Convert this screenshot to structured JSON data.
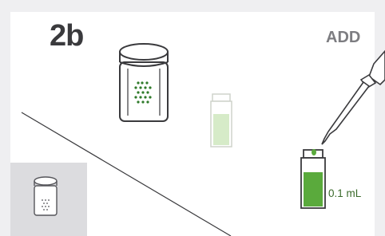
{
  "step": {
    "label": "2b"
  },
  "action": {
    "label": "ADD"
  },
  "volume": {
    "label": "0.1 mL"
  },
  "colors": {
    "background": "#efeff1",
    "panel": "#ffffff",
    "thumbnail_background": "#dcdcdf",
    "liquid_green": "#5aaa3c",
    "liquid_green_faded": "#d6ebc8",
    "dot_green": "#2f7a2a",
    "outline": "#3a3a3d"
  },
  "icons": {
    "jar": "reagent-jar-icon",
    "empty_cuvette": "cuvette-faded-icon",
    "filled_cuvette": "cuvette-filled-icon",
    "pipette": "pipette-icon",
    "thumbnail": "jar-thumbnail-icon"
  }
}
